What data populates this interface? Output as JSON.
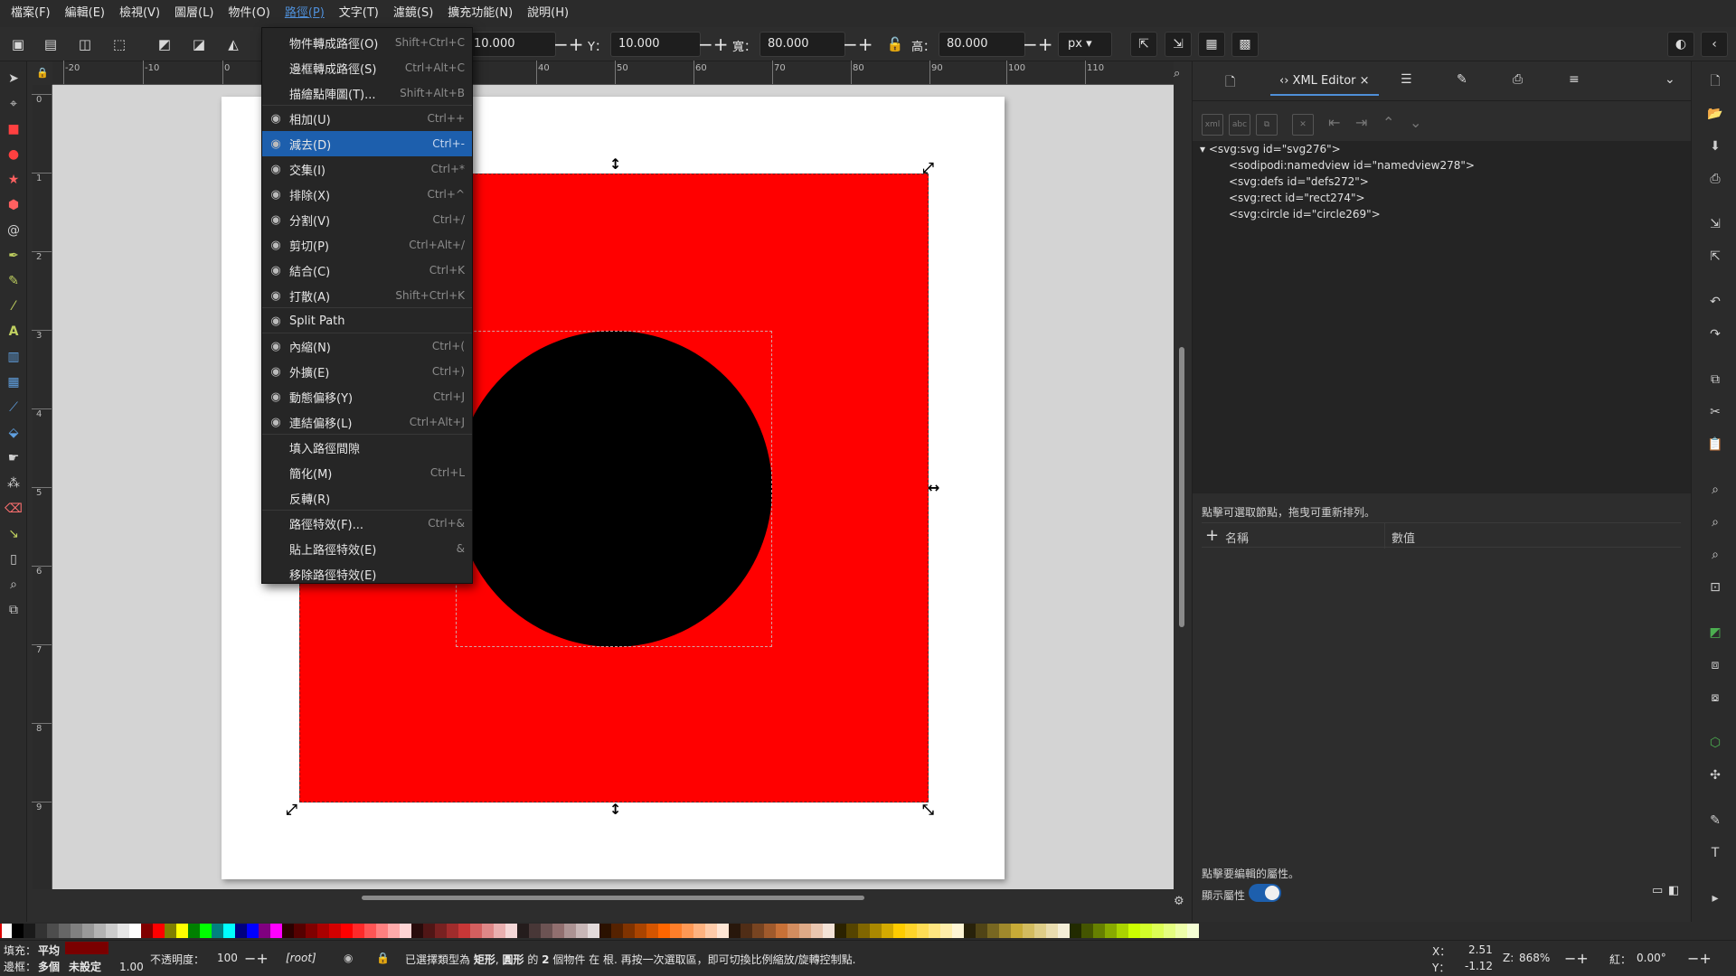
{
  "menubar": [
    "檔案(F)",
    "編輯(E)",
    "檢視(V)",
    "圖層(L)",
    "物件(O)",
    "路徑(P)",
    "文字(T)",
    "濾鏡(S)",
    "擴充功能(N)",
    "說明(H)"
  ],
  "toolctrl": {
    "x_value": "10.000",
    "y_label": "Y：",
    "y_value": "10.000",
    "w_label": "寬：",
    "w_value": "80.000",
    "h_label": "高：",
    "h_value": "80.000",
    "unit": "px"
  },
  "path_menu": [
    {
      "label": "物件轉成路徑(O)",
      "shortcut": "Shift+Ctrl+C",
      "icon": ""
    },
    {
      "label": "邊框轉成路徑(S)",
      "shortcut": "Ctrl+Alt+C",
      "icon": ""
    },
    {
      "label": "描繪點陣圖(T)...",
      "shortcut": "Shift+Alt+B",
      "icon": ""
    },
    {
      "label": "相加(U)",
      "shortcut": "Ctrl++",
      "icon": "union-icon"
    },
    {
      "label": "減去(D)",
      "shortcut": "Ctrl+-",
      "icon": "difference-icon"
    },
    {
      "label": "交集(I)",
      "shortcut": "Ctrl+*",
      "icon": "intersection-icon"
    },
    {
      "label": "排除(X)",
      "shortcut": "Ctrl+^",
      "icon": "exclusion-icon"
    },
    {
      "label": "分割(V)",
      "shortcut": "Ctrl+/",
      "icon": "division-icon"
    },
    {
      "label": "剪切(P)",
      "shortcut": "Ctrl+Alt+/",
      "icon": "cut-path-icon"
    },
    {
      "label": "結合(C)",
      "shortcut": "Ctrl+K",
      "icon": "combine-icon"
    },
    {
      "label": "打散(A)",
      "shortcut": "Shift+Ctrl+K",
      "icon": "break-apart-icon"
    },
    {
      "label": "Split Path",
      "shortcut": "",
      "icon": "split-path-icon"
    },
    {
      "label": "內縮(N)",
      "shortcut": "Ctrl+(",
      "icon": "inset-icon"
    },
    {
      "label": "外擴(E)",
      "shortcut": "Ctrl+)",
      "icon": "outset-icon"
    },
    {
      "label": "動態偏移(Y)",
      "shortcut": "Ctrl+J",
      "icon": "dynamic-offset-icon"
    },
    {
      "label": "連結偏移(L)",
      "shortcut": "Ctrl+Alt+J",
      "icon": "linked-offset-icon"
    },
    {
      "label": "填入路徑間隙",
      "shortcut": "",
      "icon": ""
    },
    {
      "label": "簡化(M)",
      "shortcut": "Ctrl+L",
      "icon": ""
    },
    {
      "label": "反轉(R)",
      "shortcut": "",
      "icon": ""
    },
    {
      "label": "路徑特效(F)...",
      "shortcut": "Ctrl+&",
      "icon": ""
    },
    {
      "label": "貼上路徑特效(E)",
      "shortcut": "&",
      "icon": ""
    },
    {
      "label": "移除路徑特效(E)",
      "shortcut": "",
      "icon": ""
    }
  ],
  "highlighted_menu_index": 4,
  "hruler_labels": [
    "-20",
    "-10",
    "0",
    "40",
    "50",
    "60",
    "70",
    "80",
    "90",
    "100",
    "110"
  ],
  "vruler_labels": [
    "0",
    "1",
    "2",
    "3",
    "4",
    "5",
    "6",
    "7",
    "8",
    "9"
  ],
  "dock": {
    "xml_tab_label": "XML Editor",
    "xml_nodes": [
      "<svg:svg id=\"svg276\">",
      "<sodipodi:namedview id=\"namedview278\">",
      "<svg:defs id=\"defs272\">",
      "<svg:rect id=\"rect274\">",
      "<svg:circle id=\"circle269\">"
    ],
    "hint_nodes": "點擊可選取節點，拖曳可重新排列。",
    "attr_name_header": "名稱",
    "attr_value_header": "數值",
    "hint_attrs": "點擊要編輯的屬性。",
    "show_attrs_label": "顯示屬性"
  },
  "statusbar": {
    "fill_label": "填充：",
    "fill_value": "平均",
    "stroke_label": "邊框：",
    "stroke_value": "多個",
    "stroke_extra": "未設定",
    "stroke_width": "1.00",
    "opacity_label": "不透明度：",
    "opacity_value": "100",
    "layer": "[root]",
    "message_prefix": "已選擇類型為 ",
    "message_type1": "矩形",
    "message_sep": ", ",
    "message_type2": "圓形",
    "message_mid": " 的 ",
    "message_count": "2",
    "message_suffix": " 個物件 在 根. 再按一次選取區，即可切換比例縮放/旋轉控制點.",
    "x_label": "X：",
    "x_value": "2.51",
    "y_label": "Y：",
    "y_value": "-1.12",
    "zoom_label": "Z:",
    "zoom_value": "868%",
    "rotate_label": "紅：",
    "rotate_value": "0.00°"
  },
  "colors": {
    "accent": "#1d5fad",
    "rect_fill": "#ff0000",
    "circle_fill": "#000000",
    "fill_swatch": "#7a0000"
  },
  "palette": [
    "#000000",
    "#1a1a1a",
    "#333333",
    "#4d4d4d",
    "#666666",
    "#808080",
    "#999999",
    "#b3b3b3",
    "#cccccc",
    "#e6e6e6",
    "#ffffff",
    "#800000",
    "#ff0000",
    "#808000",
    "#ffff00",
    "#008000",
    "#00ff00",
    "#008080",
    "#00ffff",
    "#000080",
    "#0000ff",
    "#800080",
    "#ff00ff",
    "#2b0000",
    "#550000",
    "#800000",
    "#aa0000",
    "#d40000",
    "#ff0000",
    "#ff2a2a",
    "#ff5555",
    "#ff8080",
    "#ffaaaa",
    "#ffd5d5",
    "#280b0b",
    "#501616",
    "#782121",
    "#a02c2c",
    "#c83737",
    "#d35f5f",
    "#de8787",
    "#e9afaf",
    "#f4d7d7",
    "#241c1c",
    "#483737",
    "#6c5353",
    "#916f6f",
    "#ac9393",
    "#c8b7b7",
    "#e3dbdb",
    "#2b1100",
    "#552200",
    "#803300",
    "#aa4400",
    "#d45500",
    "#ff6600",
    "#ff7f2a",
    "#ff9955",
    "#ffb380",
    "#ffccaa",
    "#ffe6d5",
    "#28170b",
    "#502d16",
    "#784421",
    "#a05a2c",
    "#c87137",
    "#d38d5f",
    "#deaa87",
    "#e9c6af",
    "#f4e3d7",
    "#2b2200",
    "#554400",
    "#806600",
    "#aa8800",
    "#d4aa00",
    "#ffcc00",
    "#ffd42a",
    "#ffdd55",
    "#ffe680",
    "#ffeeaa",
    "#fff6d5",
    "#28220b",
    "#504416",
    "#786721",
    "#a0892c",
    "#c8ab37",
    "#d3bc5f",
    "#decd87",
    "#e9ddaf",
    "#f4eed7",
    "#222b00",
    "#445500",
    "#668000",
    "#88aa00",
    "#aad400",
    "#ccff00",
    "#d4ff2a",
    "#ddff55",
    "#e5ff80",
    "#eeffaa",
    "#f6ffd5"
  ]
}
